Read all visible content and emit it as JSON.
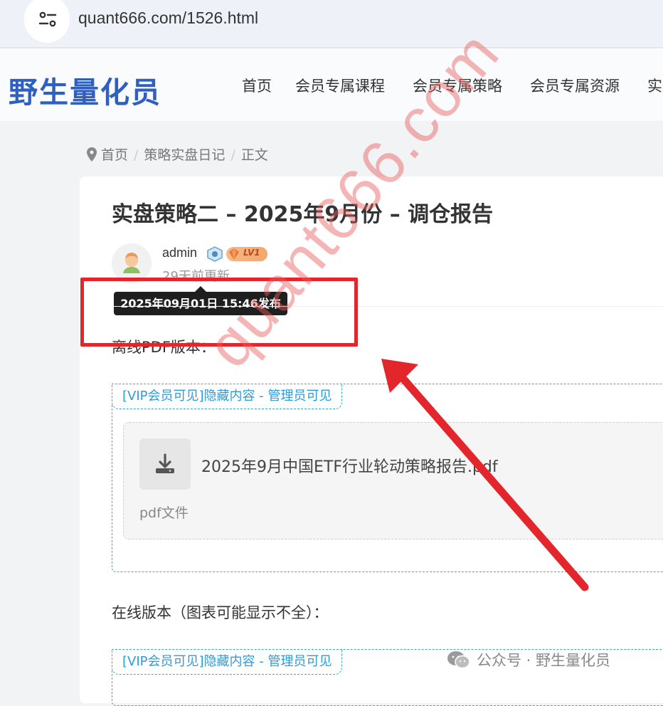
{
  "browser": {
    "url": "quant666.com/1526.html",
    "site_info_icon": "site-settings-icon"
  },
  "header": {
    "logo_text": "野生量化员",
    "nav": [
      "首页",
      "会员专属课程",
      "会员专属策略",
      "会员专属资源",
      "实"
    ]
  },
  "breadcrumb": [
    "首页",
    "策略实盘日记",
    "正文"
  ],
  "article": {
    "title": "实盘策略二 – 2025年9月份 – 调仓报告",
    "author": "admin",
    "level_badge": "LV1",
    "updated": "29天前更新",
    "tooltip": "2025年09月01日 15:46发布",
    "para1": "离线PDF版本：",
    "vip_tag": "[VIP会员可见]隐藏内容 - 管理员可见",
    "file_name": "2025年9月中国ETF行业轮动策略报告.pdf",
    "file_type": "pdf文件",
    "para2": "在线版本（图表可能显示不全）：",
    "vip_tag2": "[VIP会员可见]隐藏内容 - 管理员可见"
  },
  "overlay": {
    "watermark": "quant666.com",
    "wechat_label": "公众号 · 野生量化员",
    "highlight_color": "#e2262c"
  }
}
